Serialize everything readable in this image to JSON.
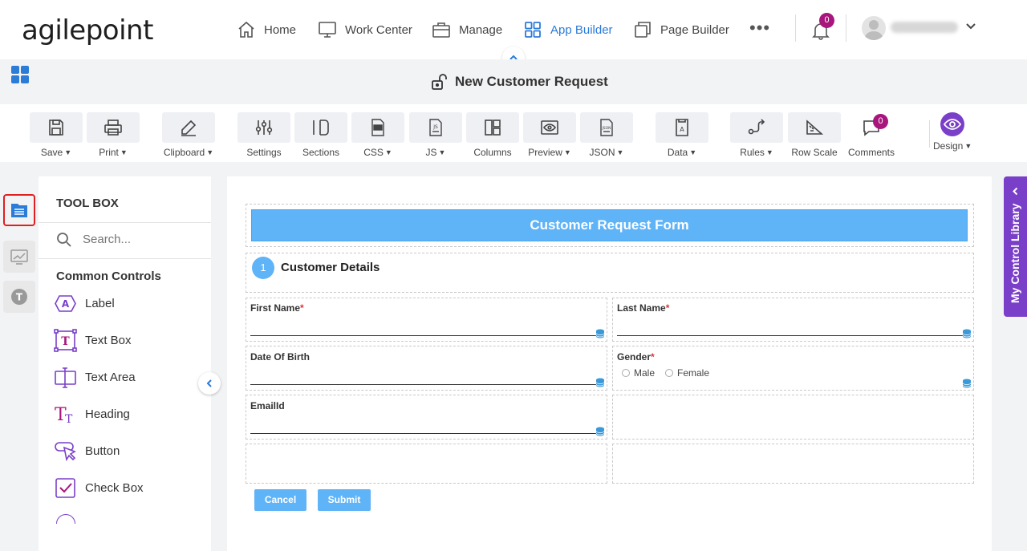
{
  "logo": "agilepoint",
  "nav": {
    "items": [
      {
        "label": "Home",
        "icon": "home-icon"
      },
      {
        "label": "Work Center",
        "icon": "monitor-icon"
      },
      {
        "label": "Manage",
        "icon": "briefcase-icon"
      },
      {
        "label": "App Builder",
        "icon": "grid-icon",
        "active": true
      },
      {
        "label": "Page Builder",
        "icon": "pages-icon"
      }
    ],
    "more": "•••",
    "notifications": "0"
  },
  "page_title": "New Customer Request",
  "toolbar": {
    "items": [
      {
        "label": "Save",
        "dropdown": true,
        "icon": "save-icon"
      },
      {
        "label": "Print",
        "dropdown": true,
        "icon": "print-icon"
      },
      {
        "label": "Clipboard",
        "dropdown": true,
        "icon": "clipboard-icon"
      },
      {
        "label": "Settings",
        "dropdown": false,
        "icon": "settings-sliders-icon"
      },
      {
        "label": "Sections",
        "dropdown": false,
        "icon": "sections-icon"
      },
      {
        "label": "CSS",
        "dropdown": true,
        "icon": "css-icon"
      },
      {
        "label": "JS",
        "dropdown": true,
        "icon": "js-icon"
      },
      {
        "label": "Columns",
        "dropdown": false,
        "icon": "columns-icon"
      },
      {
        "label": "Preview",
        "dropdown": true,
        "icon": "preview-icon"
      },
      {
        "label": "JSON",
        "dropdown": true,
        "icon": "json-icon"
      },
      {
        "label": "Data",
        "dropdown": true,
        "icon": "data-icon"
      },
      {
        "label": "Rules",
        "dropdown": true,
        "icon": "rules-icon"
      },
      {
        "label": "Row Scale",
        "dropdown": false,
        "icon": "row-scale-icon"
      },
      {
        "label": "Comments",
        "dropdown": false,
        "icon": "comments-icon"
      },
      {
        "label": "Design",
        "dropdown": true,
        "icon": "design-eye-icon"
      }
    ],
    "comments_badge": "0"
  },
  "toolbox": {
    "title": "TOOL BOX",
    "search_placeholder": "Search...",
    "section": "Common Controls",
    "controls": [
      "Label",
      "Text Box",
      "Text Area",
      "Heading",
      "Button",
      "Check Box"
    ]
  },
  "form": {
    "header": "Customer Request Form",
    "step_number": "1",
    "section_title": "Customer Details",
    "fields": {
      "first_name": "First Name",
      "last_name": "Last Name",
      "dob": "Date Of Birth",
      "gender": "Gender",
      "email": "EmailId",
      "required_mark": "*"
    },
    "gender_options": [
      "Male",
      "Female"
    ],
    "cancel": "Cancel",
    "submit": "Submit"
  },
  "my_control_library": "My Control Library",
  "colors": {
    "accent": "#2b7bd9",
    "purple": "#7a3fc8",
    "badge": "#a8157c",
    "form_header": "#5fb3f7"
  }
}
